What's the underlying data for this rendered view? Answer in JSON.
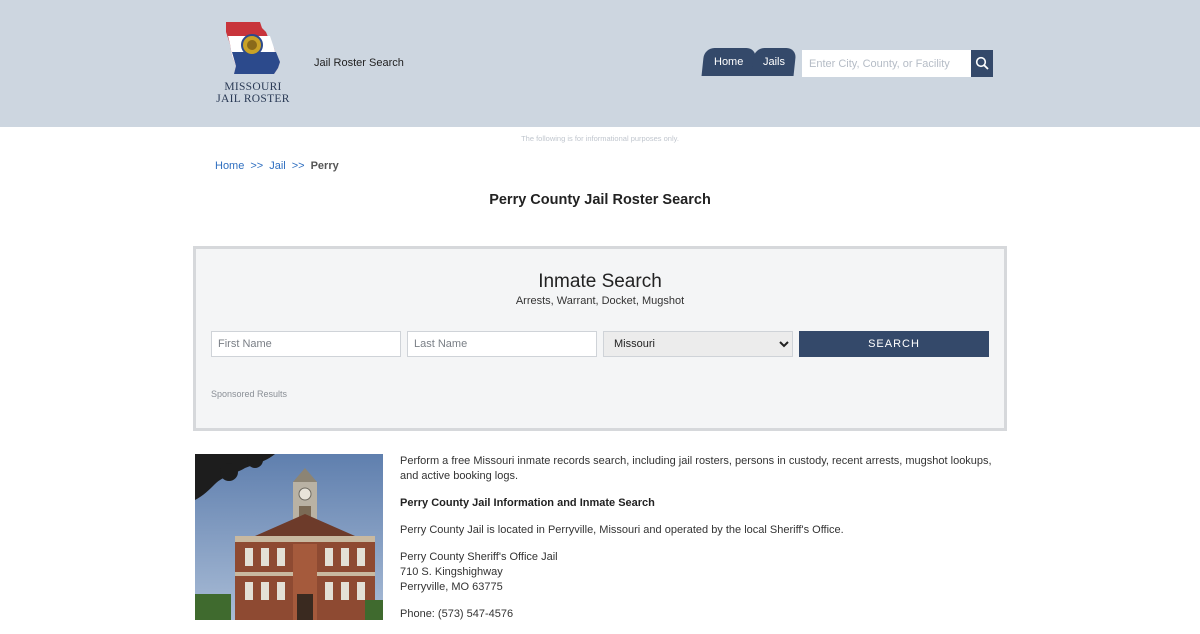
{
  "header": {
    "logo_text_line1": "MISSOURI",
    "logo_text_line2": "JAIL ROSTER",
    "site_name": "Jail Roster Search",
    "nav": [
      {
        "label": "Home"
      },
      {
        "label": "Jails"
      }
    ],
    "search_placeholder": "Enter City, County, or Facility",
    "search_icon": "magnifier-icon"
  },
  "notice": "The following is for informational purposes only.",
  "breadcrumb": {
    "items": [
      "Home",
      "Jail"
    ],
    "separator": ">>",
    "current": "Perry"
  },
  "page_title": "Perry County Jail Roster Search",
  "inmate_search": {
    "title": "Inmate Search",
    "subtitle": "Arrests, Warrant, Docket, Mugshot",
    "first_name_placeholder": "First Name",
    "last_name_placeholder": "Last Name",
    "state_selected": "Missouri",
    "submit_label": "SEARCH",
    "sponsored": "Sponsored Results"
  },
  "content": {
    "intro": "Perform a free Missouri inmate records search, including jail rosters, persons in custody, recent arrests, mugshot lookups, and active booking logs.",
    "heading": "Perry County Jail Information and Inmate Search",
    "location": "Perry County Jail is located in Perryville, Missouri and operated by the local Sheriff's Office.",
    "address_name": "Perry County Sheriff's Office Jail",
    "address_street": "710 S. Kingshighway",
    "address_city": "Perryville, MO 63775",
    "phone": "Phone: (573) 547-4576"
  },
  "colors": {
    "header_bg": "#cdd6e0",
    "accent": "#34496a",
    "link": "#2f6fc0"
  }
}
